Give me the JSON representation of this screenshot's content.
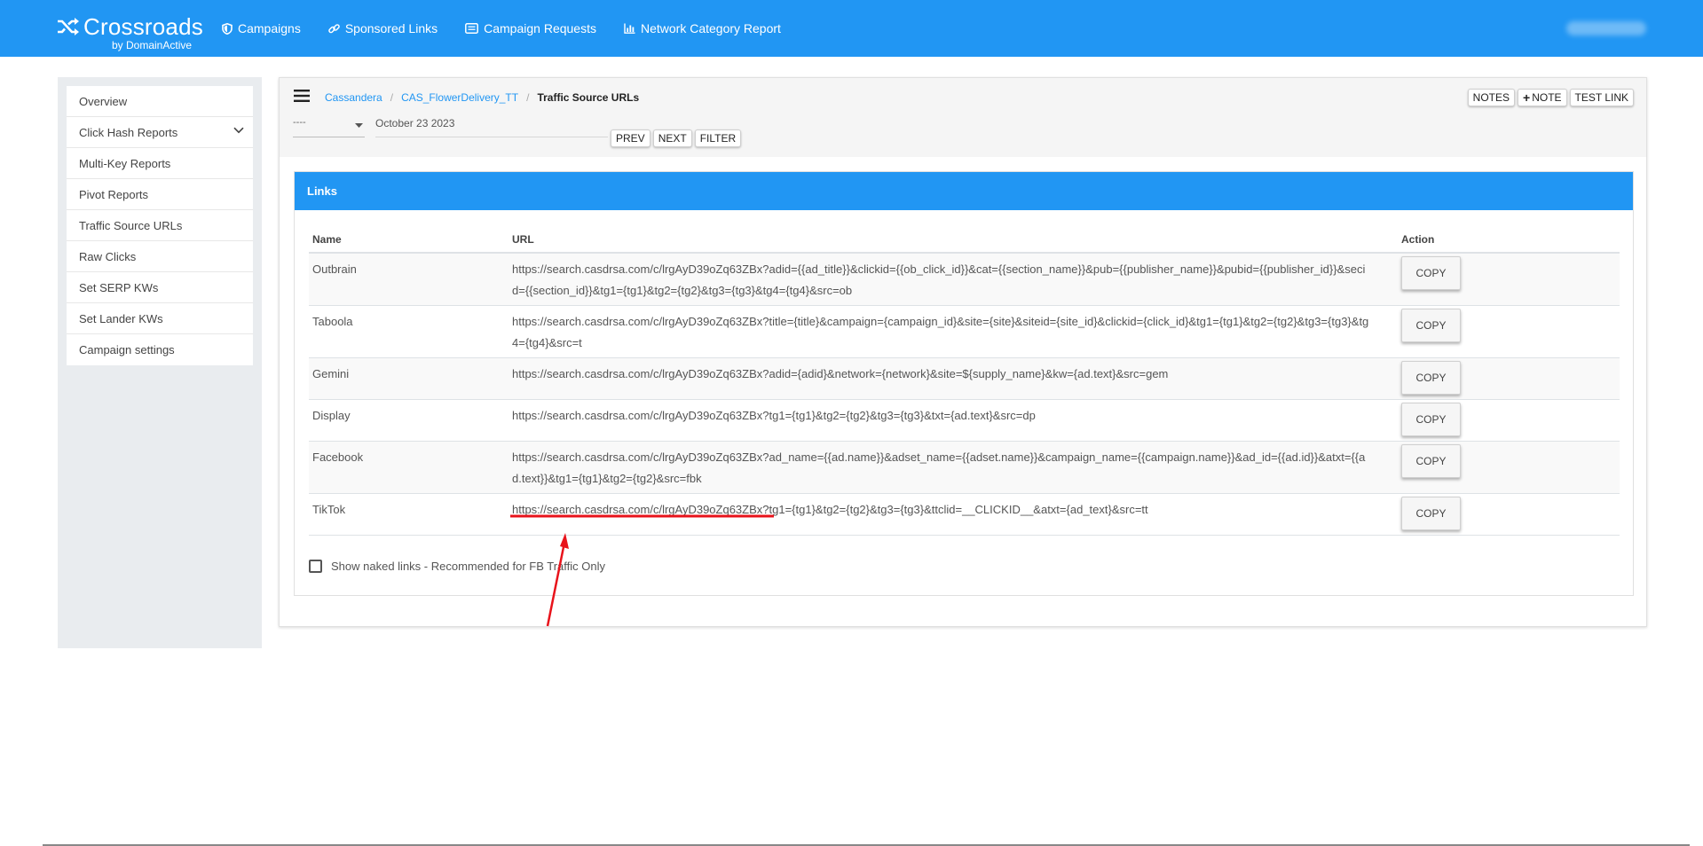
{
  "topbar": {
    "brand": "Crossroads",
    "brand_sub": "by DomainActive",
    "nav": [
      {
        "label": "Campaigns",
        "icon": "shield-icon"
      },
      {
        "label": "Sponsored Links",
        "icon": "link-icon"
      },
      {
        "label": "Campaign Requests",
        "icon": "list-card-icon"
      },
      {
        "label": "Network Category Report",
        "icon": "bar-chart-icon"
      }
    ],
    "accent": "#2196f3"
  },
  "sidebar": {
    "items": [
      {
        "label": "Overview"
      },
      {
        "label": "Click Hash Reports",
        "icon": "chevron-down-icon"
      },
      {
        "label": "Multi-Key Reports"
      },
      {
        "label": "Pivot Reports"
      },
      {
        "label": "Traffic Source URLs"
      },
      {
        "label": "Raw Clicks"
      },
      {
        "label": "Set SERP KWs"
      },
      {
        "label": "Set Lander KWs"
      },
      {
        "label": "Campaign settings"
      }
    ]
  },
  "breadcrumb": {
    "items": [
      "Cassandera",
      "CAS_FlowerDelivery_TT"
    ],
    "current": "Traffic Source URLs"
  },
  "header_buttons": {
    "notes": "NOTES",
    "add_note": "NOTE",
    "test_link": "TEST LINK"
  },
  "filters": {
    "select_value": "----",
    "date": "October 23 2023",
    "prev": "PREV",
    "next": "NEXT",
    "filter": "FILTER"
  },
  "links": {
    "title": "Links",
    "columns": [
      "Name",
      "URL",
      "Action"
    ],
    "copy_label": "COPY",
    "rows": [
      {
        "name": "Outbrain",
        "url": "https://search.casdrsa.com/c/lrgAyD39oZq63ZBx?adid={{ad_title}}&clickid={{ob_click_id}}&cat={{section_name}}&pub={{publisher_name}}&pubid={{publisher_id}}&secid={{section_id}}&tg1={tg1}&tg2={tg2}&tg3={tg3}&tg4={tg4}&src=ob"
      },
      {
        "name": "Taboola",
        "url": "https://search.casdrsa.com/c/lrgAyD39oZq63ZBx?title={title}&campaign={campaign_id}&site={site}&siteid={site_id}&clickid={click_id}&tg1={tg1}&tg2={tg2}&tg3={tg3}&tg4={tg4}&src=t"
      },
      {
        "name": "Gemini",
        "url": "https://search.casdrsa.com/c/lrgAyD39oZq63ZBx?adid={adid}&network={network}&site=${supply_name}&kw={ad.text}&src=gem"
      },
      {
        "name": "Display",
        "url": "https://search.casdrsa.com/c/lrgAyD39oZq63ZBx?tg1={tg1}&tg2={tg2}&tg3={tg3}&txt={ad.text}&src=dp"
      },
      {
        "name": "Facebook",
        "url": "https://search.casdrsa.com/c/lrgAyD39oZq63ZBx?ad_name={{ad.name}}&adset_name={{adset.name}}&campaign_name={{campaign.name}}&ad_id={{ad.id}}&atxt={{ad.text}}&tg1={tg1}&tg2={tg2}&src=fbk"
      },
      {
        "name": "TikTok",
        "url": "https://search.casdrsa.com/c/lrgAyD39oZq63ZBx?tg1={tg1}&tg2={tg2}&tg3={tg3}&ttclid=__CLICKID__&atxt={ad_text}&src=tt"
      }
    ],
    "naked_links_label": "Show naked links - Recommended for FB Traffic Only",
    "naked_links_checked": false
  },
  "annotation_color": "#e8131b"
}
